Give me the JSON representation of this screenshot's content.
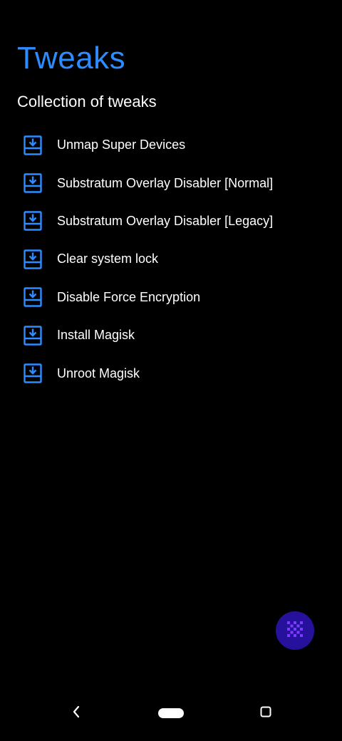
{
  "header": {
    "title": "Tweaks",
    "subtitle": "Collection of tweaks"
  },
  "tweaks": [
    {
      "label": "Unmap Super Devices",
      "icon": "download-tray-icon"
    },
    {
      "label": "Substratum Overlay Disabler [Normal]",
      "icon": "download-tray-icon"
    },
    {
      "label": "Substratum Overlay Disabler [Legacy]",
      "icon": "download-tray-icon"
    },
    {
      "label": "Clear system lock",
      "icon": "download-tray-icon"
    },
    {
      "label": "Disable Force Encryption",
      "icon": "download-tray-icon"
    },
    {
      "label": "Install Magisk",
      "icon": "download-tray-icon"
    },
    {
      "label": "Unroot Magisk",
      "icon": "download-tray-icon"
    }
  ],
  "fab": {
    "icon": "checker-grid-icon"
  },
  "navigation": {
    "back_icon": "back-chevron-icon",
    "home_icon": "home-pill-icon",
    "recents_icon": "recents-square-icon"
  },
  "colors": {
    "background": "#000000",
    "accent": "#2d8cff",
    "fab_background": "#26119c",
    "fab_icon": "#7c3cff",
    "text": "#ffffff"
  }
}
